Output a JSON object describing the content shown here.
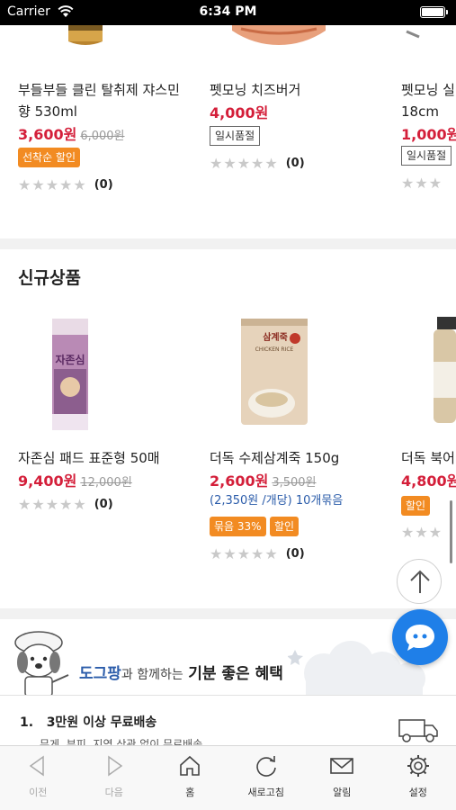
{
  "status_bar": {
    "carrier": "Carrier",
    "time": "6:34 PM"
  },
  "top_row": [
    {
      "name_line1": "부들부들 클린 탈취제 쟈스민",
      "name_line2": "향 530ml",
      "price": "3,600원",
      "original_price": "6,000원",
      "badge": "선착순 할인",
      "stars": "★★★★★",
      "review_count": "(0)"
    },
    {
      "name_line1": "펫모닝 치즈버거",
      "price": "4,000원",
      "badge": "일시품절",
      "stars": "★★★★★",
      "review_count": "(0)"
    },
    {
      "name_line1": "펫모닝 실",
      "name_line2": "18cm",
      "price": "1,000원",
      "badge": "일시품절",
      "stars": "★★★",
      "review_count": ""
    }
  ],
  "new_products": {
    "title": "신규상품",
    "items": [
      {
        "name": "자존심 패드 표준형 50매",
        "price": "9,400원",
        "original_price": "12,000원",
        "stars": "★★★★★",
        "review_count": "(0)",
        "thumb_text": "자존심"
      },
      {
        "name": "더독 수제삼계죽 150g",
        "price": "2,600원",
        "original_price": "3,500원",
        "unit_price": "(2,350원 /개당) 10개묶음",
        "badges": [
          "묶음 33%",
          "할인"
        ],
        "stars": "★★★★★",
        "review_count": "(0)",
        "thumb_text": "삼계죽",
        "thumb_subtext": "CHICKEN RICE"
      },
      {
        "name": "더독 북어",
        "price": "4,800원",
        "badge": "할인",
        "stars": "★★★",
        "review_count": ""
      }
    ]
  },
  "benefit": {
    "brand": "도그팡",
    "middle": "과 함께하는",
    "strong": "기분 좋은 혜택",
    "item_no": "1.",
    "item_title": "3만원 이상 무료배송",
    "item_sub": "무게, 부피, 지역 상관 없이 무료배송"
  },
  "toolbar": [
    {
      "label": "이전",
      "icon": "back-arrow-icon"
    },
    {
      "label": "다음",
      "icon": "forward-arrow-icon"
    },
    {
      "label": "홈",
      "icon": "home-icon"
    },
    {
      "label": "새로고침",
      "icon": "refresh-icon"
    },
    {
      "label": "알림",
      "icon": "mail-icon"
    },
    {
      "label": "설정",
      "icon": "gear-icon"
    }
  ],
  "colors": {
    "price_red": "#d41f3a",
    "badge_orange": "#f28b22",
    "brand_blue": "#2b5caa",
    "chat_blue": "#1f7fe8"
  }
}
